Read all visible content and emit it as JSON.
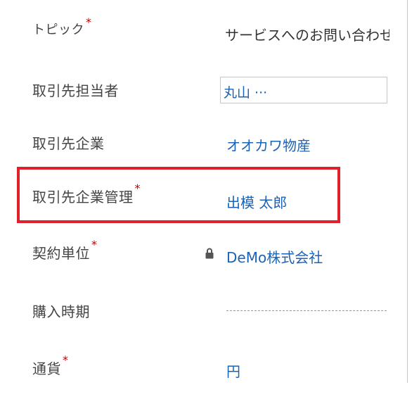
{
  "form": {
    "topic": {
      "label": "トピック",
      "required": "*",
      "value": "サービスへのお問い合わせ"
    },
    "contact": {
      "label": "取引先担当者",
      "value": "丸山 ···"
    },
    "account": {
      "label": "取引先企業",
      "value": "オオカワ物産"
    },
    "account_manager": {
      "label": "取引先企業管理",
      "required": "*",
      "value": "出模 太郎"
    },
    "contract_unit": {
      "label": "契約単位",
      "required": "*",
      "value": "DeMo株式会社"
    },
    "purchase_timeframe": {
      "label": "購入時期",
      "value": ""
    },
    "currency": {
      "label": "通貨",
      "required": "*",
      "value": "円"
    }
  },
  "colors": {
    "link": "#1b63b6",
    "required": "#c00000",
    "highlight": "#e0202a"
  }
}
